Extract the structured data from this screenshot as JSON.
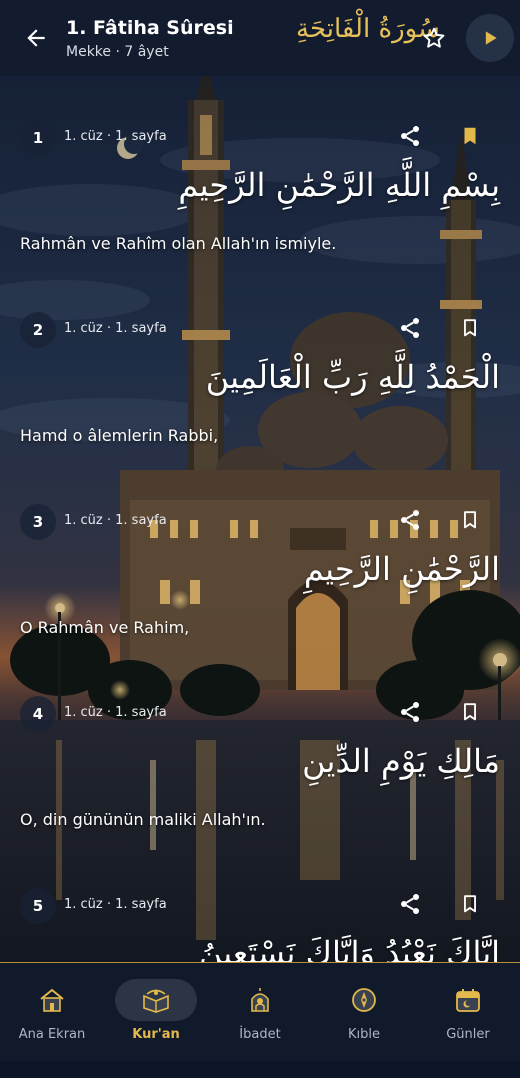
{
  "header": {
    "title": "1. Fâtiha Sûresi",
    "subtitle": "Mekke · 7 âyet",
    "arabic_title": "سُورَةُ الْفَاتِحَةِ"
  },
  "colors": {
    "accent": "#e4b94c",
    "header_bg": "#121c2e",
    "nav_bg": "#101a2b"
  },
  "verses": [
    {
      "number": "1",
      "meta": "1. cüz · 1. sayfa",
      "arabic": "بِسْمِ اللَّهِ الرَّحْمَٰنِ الرَّحِيمِ",
      "meaning": "Rahmân ve Rahîm olan Allah'ın ismiyle.",
      "bookmarked": true
    },
    {
      "number": "2",
      "meta": "1. cüz · 1. sayfa",
      "arabic": "الْحَمْدُ لِلَّهِ رَبِّ الْعَالَمِينَ",
      "meaning": "Hamd o âlemlerin Rabbi,",
      "bookmarked": false
    },
    {
      "number": "3",
      "meta": "1. cüz · 1. sayfa",
      "arabic": "الرَّحْمَٰنِ الرَّحِيمِ",
      "meaning": "O Rahmân ve Rahim,",
      "bookmarked": false
    },
    {
      "number": "4",
      "meta": "1. cüz · 1. sayfa",
      "arabic": "مَالِكِ يَوْمِ الدِّينِ",
      "meaning": "O, din gününün maliki Allah'ın.",
      "bookmarked": false
    },
    {
      "number": "5",
      "meta": "1. cüz · 1. sayfa",
      "arabic": "إِيَّاكَ نَعْبُدُ وَإِيَّاكَ نَسْتَعِينُ",
      "meaning": "",
      "bookmarked": false
    }
  ],
  "nav": {
    "items": [
      {
        "label": "Ana Ekran",
        "icon": "home-icon",
        "active": false
      },
      {
        "label": "Kur'an",
        "icon": "quran-icon",
        "active": true
      },
      {
        "label": "İbadet",
        "icon": "prayer-icon",
        "active": false
      },
      {
        "label": "Kıble",
        "icon": "compass-icon",
        "active": false
      },
      {
        "label": "Günler",
        "icon": "calendar-icon",
        "active": false
      }
    ]
  }
}
